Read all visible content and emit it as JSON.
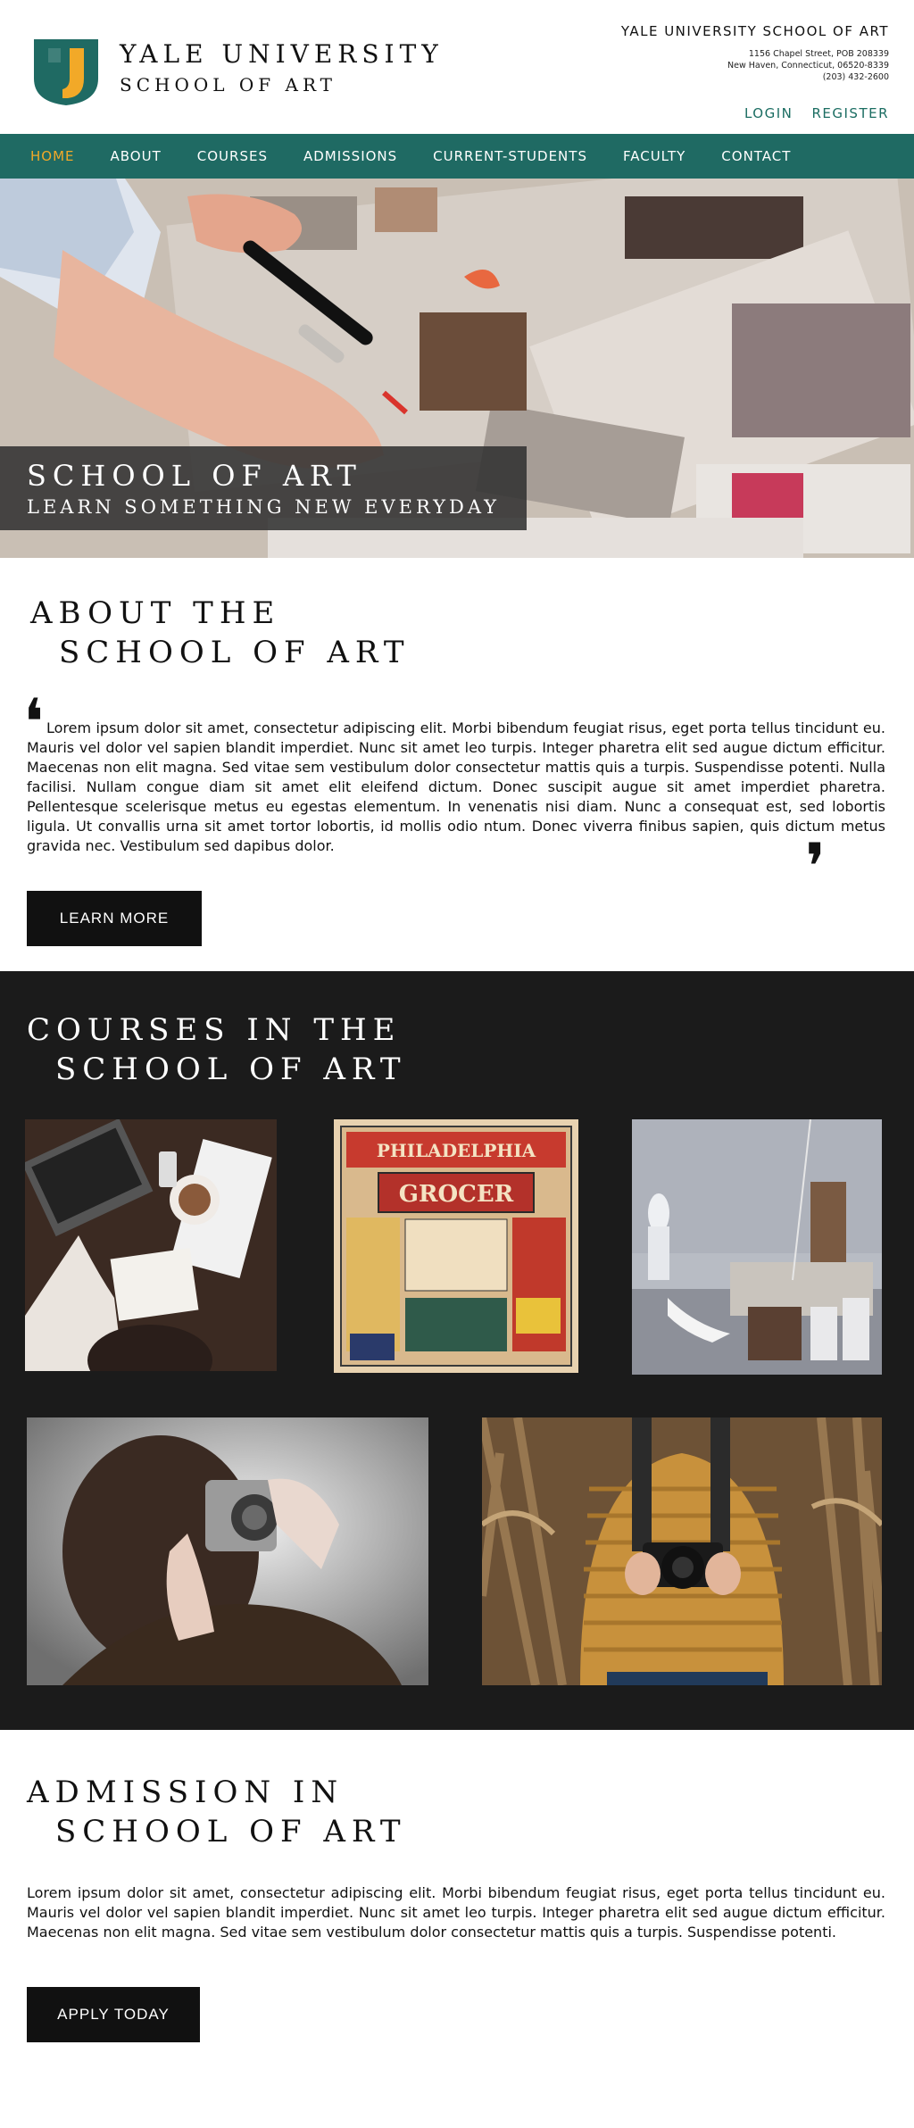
{
  "header": {
    "brand_line1": "YALE UNIVERSITY",
    "brand_line2": "SCHOOL OF ART",
    "contact_title": "YALE UNIVERSITY SCHOOL OF ART",
    "address_line1": "1156 Chapel Street, POB 208339",
    "address_line2": "New Haven, Connecticut, 06520-8339",
    "phone": "(203) 432-2600",
    "login_label": "LOGIN",
    "register_label": "REGISTER"
  },
  "nav": {
    "items": [
      {
        "label": "HOME",
        "active": true
      },
      {
        "label": "ABOUT",
        "active": false
      },
      {
        "label": "COURSES",
        "active": false
      },
      {
        "label": "ADMISSIONS",
        "active": false
      },
      {
        "label": "CURRENT-STUDENTS",
        "active": false
      },
      {
        "label": "FACULTY",
        "active": false
      },
      {
        "label": "CONTACT",
        "active": false
      }
    ],
    "active_color": "#f2a928",
    "bar_color": "#1f6a63"
  },
  "hero": {
    "title": "SCHOOL OF ART",
    "subtitle": "LEARN SOMETHING NEW EVERYDAY"
  },
  "about": {
    "title_line1": "ABOUT THE",
    "title_line2": "SCHOOL OF ART",
    "body": "Lorem ipsum dolor sit amet, consectetur adipiscing elit. Morbi bibendum feugiat risus, eget porta tellus tincidunt eu. Mauris vel dolor vel sapien blandit imperdiet. Nunc sit amet leo turpis. Integer pharetra elit sed augue dictum efficitur. Maecenas non elit magna. Sed vitae sem vestibulum dolor consectetur mattis quis a turpis. Suspendisse potenti. Nulla facilisi. Nullam congue diam sit amet elit eleifend dictum. Donec suscipit augue sit amet imperdiet pharetra. Pellentesque scelerisque metus eu egestas elementum. In venenatis nisi diam. Nunc a consequat est, sed lobortis ligula. Ut convallis urna sit amet tortor lobortis, id mollis odio ntum. Donec viverra finibus sapien, quis dictum metus gravida nec. Vestibulum sed dapibus dolor.",
    "quote_open": "❛",
    "quote_close": "❜",
    "button_label": "LEARN MORE"
  },
  "courses": {
    "title_line1": "COURSES IN THE",
    "title_line2": "SCHOOL OF ART",
    "poster_text_1": "PHILADELPHIA",
    "poster_text_2": "GROCER"
  },
  "admission": {
    "title_line1": "ADMISSION IN",
    "title_line2": "SCHOOL OF ART",
    "body": "Lorem ipsum dolor sit amet, consectetur adipiscing elit. Morbi bibendum feugiat risus, eget porta tellus tincidunt eu. Mauris vel dolor vel sapien blandit imperdiet. Nunc sit amet leo turpis. Integer pharetra elit sed augue dictum efficitur. Maecenas non elit magna. Sed vitae sem vestibulum dolor consectetur mattis quis a turpis. Suspendisse potenti.",
    "button_label": "APPLY TODAY"
  }
}
